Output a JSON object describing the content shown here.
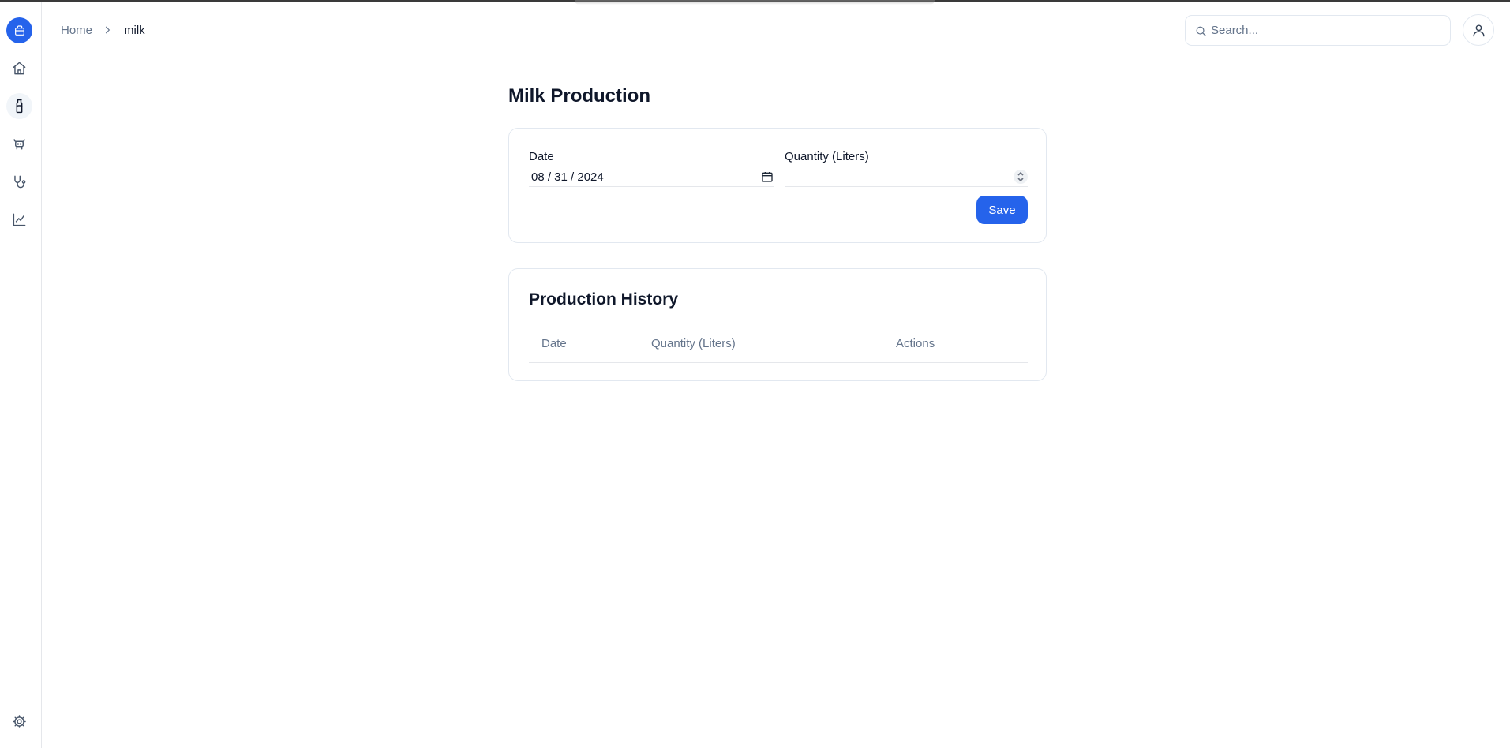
{
  "breadcrumb": {
    "home": "Home",
    "current": "milk"
  },
  "search": {
    "placeholder": "Search..."
  },
  "page": {
    "title": "Milk Production"
  },
  "form": {
    "date_label": "Date",
    "date_value": "08 / 31 / 2024",
    "quantity_label": "Quantity (Liters)",
    "quantity_value": "",
    "save_label": "Save"
  },
  "history": {
    "title": "Production History",
    "columns": [
      "Date",
      "Quantity (Liters)",
      "Actions"
    ],
    "rows": []
  },
  "sidebar": {
    "items": [
      {
        "icon": "app-logo-icon"
      },
      {
        "icon": "home-icon"
      },
      {
        "icon": "milk-bottle-icon",
        "active": true
      },
      {
        "icon": "cow-icon"
      },
      {
        "icon": "stethoscope-icon"
      },
      {
        "icon": "chart-line-icon"
      },
      {
        "icon": "gear-icon"
      }
    ]
  },
  "colors": {
    "accent": "#2563eb",
    "muted": "#64748b",
    "border": "#e2e8f0"
  }
}
